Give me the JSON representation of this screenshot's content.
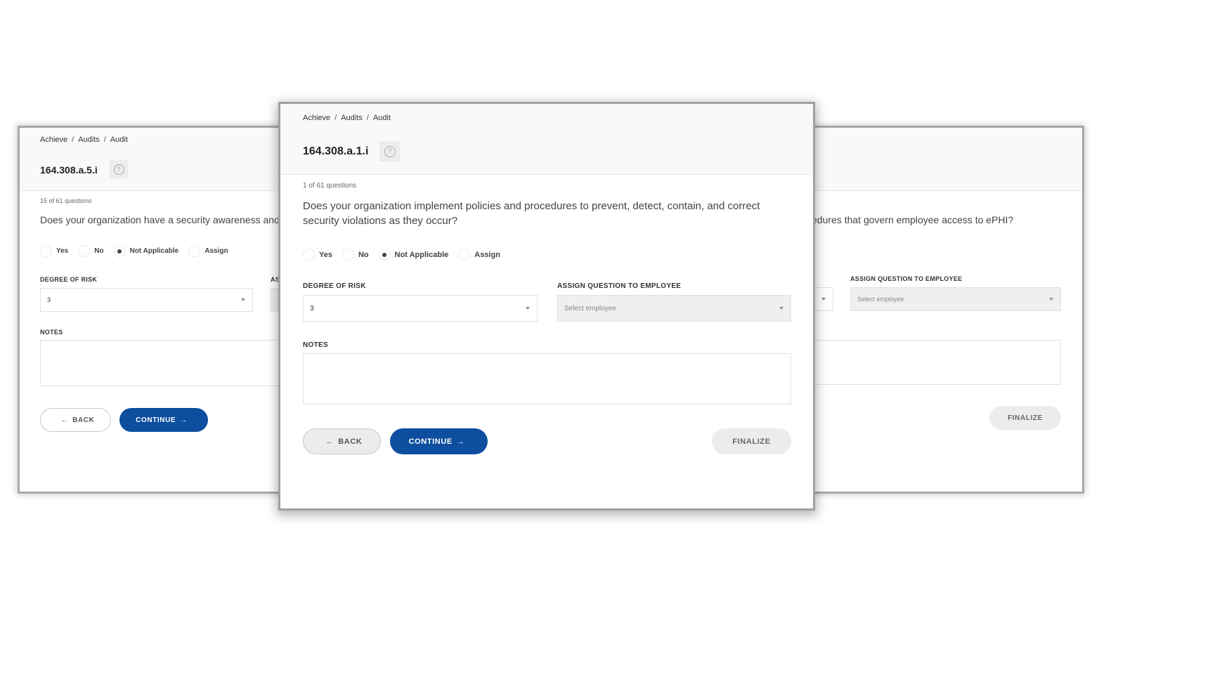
{
  "colors": {
    "primary": "#0d4e9e",
    "header_bg": "#f9f9f9",
    "disabled_bg": "#ececec"
  },
  "panels": {
    "left": {
      "breadcrumb": [
        "Achieve",
        "Audits",
        "Audit"
      ],
      "code": "164.308.a.5.i",
      "help_icon": "question-circle-icon",
      "count": "15 of 61 questions",
      "question": "Does your organization have a security awareness and tr",
      "options": [
        "Yes",
        "No",
        "Not Applicable",
        "Assign"
      ],
      "selected": "Not Applicable",
      "risk_label": "DEGREE OF RISK",
      "risk_value": "3",
      "assign_label_partial": "AS",
      "assign_placeholder_partial": "S",
      "notes_label": "NOTES",
      "back_label": "BACK",
      "continue_label": "CONTINUE"
    },
    "center": {
      "breadcrumb": [
        "Achieve",
        "Audits",
        "Audit"
      ],
      "code": "164.308.a.1.i",
      "help_icon": "question-circle-icon",
      "count": "1 of 61 questions",
      "question": "Does your organization implement policies and procedures to prevent, detect, contain, and correct security violations as they occur?",
      "options": [
        "Yes",
        "No",
        "Not Applicable",
        "Assign"
      ],
      "selected": "Not Applicable",
      "risk_label": "DEGREE OF RISK",
      "risk_value": "3",
      "assign_label": "ASSIGN QUESTION TO EMPLOYEE",
      "assign_placeholder": "Select employee",
      "notes_label": "NOTES",
      "notes_value": "",
      "back_label": "BACK",
      "continue_label": "CONTINUE",
      "finalize_label": "FINALIZE"
    },
    "right": {
      "question_partial": "edures that govern employee access to ePHI?",
      "assign_label": "ASSIGN QUESTION TO EMPLOYEE",
      "assign_placeholder": "Select employee",
      "finalize_label": "FINALIZE"
    }
  },
  "icons": {
    "back_arrow": "←",
    "continue_arrow": "→",
    "help": "?"
  }
}
